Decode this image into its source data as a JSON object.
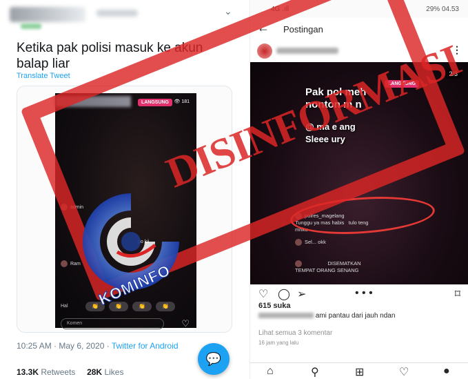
{
  "tweet": {
    "chevron_icon": "chevron-down-icon",
    "text": "Ketika pak polisi masuk ke akun balap liar",
    "translate": "Translate Tweet",
    "video": {
      "live_badge": "LANGSUNG",
      "viewers": "181",
      "comments": [
        "admin",
        "po kii",
        "Ram"
      ],
      "hello": "Hal",
      "comment_placeholder": "Komen"
    },
    "meta": {
      "time": "10:25 AM · May 6, 2020 · ",
      "source": "Twitter for Android"
    },
    "stats": {
      "retweets_count": "13.3K",
      "retweets_label": "Retweets",
      "likes_count": "28K",
      "likes_label": "Likes"
    },
    "fab_icon": "reply-icon"
  },
  "instagram": {
    "status": {
      "signal": "4G .ıll",
      "battery": "29%",
      "time": "04.53"
    },
    "header_title": "Postingan",
    "post": {
      "counter": "2/3",
      "live_badge": "LANGSUNG",
      "caption_line1": "Pak pol meh",
      "caption_line2": "nonton m n",
      "caption_line3": "@ ma e ang",
      "caption_line4": "Sleee ury",
      "highlight_user": "polres_magelang",
      "highlight_text1": "Tunggu ya mas habis",
      "highlight_text2": "mriku",
      "highlight_text3": "tulo teng",
      "other_text": "Sel... okk",
      "pinned_label": "DISEMATKAN",
      "pinned_text": "TEMPAT ORANG SENANG"
    },
    "likes": "615 suka",
    "caption": "ami pantau dari jauh ndan",
    "view_comments": "Lihat semua 3 komentar",
    "time_ago": "16 jam yang lalu"
  },
  "overlay": {
    "stamp": "DISINFORMASI",
    "logo_text": "KOMINFO",
    "stamp_color": "#dc2626",
    "logo_color": "#1e40af"
  }
}
